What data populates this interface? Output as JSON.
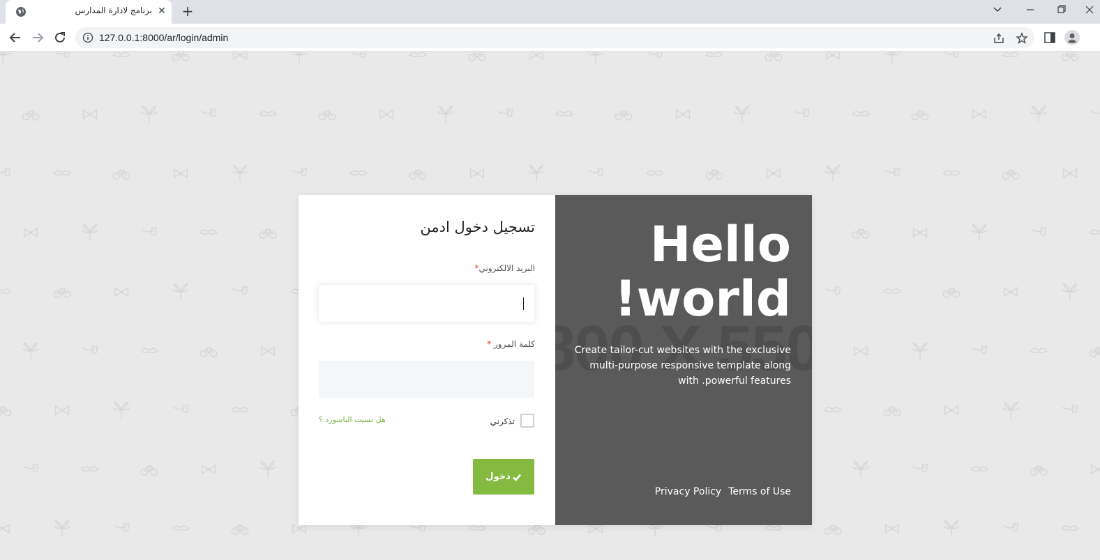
{
  "browser": {
    "tab_title": "برنامج لادارة المدارس",
    "url_host": "127.0.0.1",
    "url_rest": ":8000/ar/login/admin"
  },
  "form": {
    "title": "تسجيل دخول ادمن",
    "email_label": "البريد الالكتروني",
    "email_required": "*",
    "email_value": "",
    "password_label": "كلمة المرور",
    "password_required": "*",
    "password_value": "",
    "remember_label": "تذكرني",
    "forgot_link": "هل نسيت الباسورد ؟",
    "login_button": "دخول"
  },
  "promo": {
    "watermark": "800 X 550",
    "hello_line1": "Hello",
    "hello_line2": "!world",
    "description": "Create tailor-cut websites with the exclusive multi-purpose responsive template along with .powerful features",
    "privacy_link": "Privacy Policy",
    "terms_link": "Terms of Use"
  },
  "colors": {
    "accent_green": "#84ba3f",
    "promo_bg": "#5a5a5a",
    "page_bg": "#e9e9e9"
  }
}
